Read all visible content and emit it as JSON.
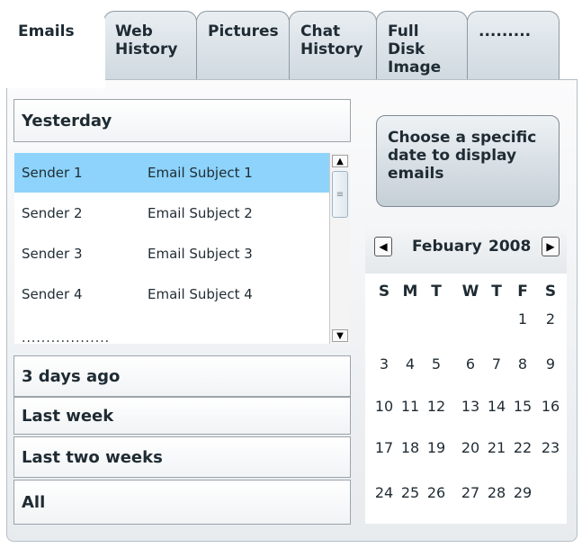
{
  "tabs": [
    {
      "label": "Emails",
      "active": true
    },
    {
      "label": "Web History",
      "active": false
    },
    {
      "label": "Pictures",
      "active": false
    },
    {
      "label": "Chat History",
      "active": false
    },
    {
      "label": "Full Disk Image",
      "active": false
    },
    {
      "label": ".........",
      "active": false
    }
  ],
  "groups": {
    "yesterday": "Yesterday",
    "three_days": "3 days ago",
    "last_week": "Last week",
    "last_two_weeks": "Last two weeks",
    "all": "All"
  },
  "emails": [
    {
      "sender": "Sender 1",
      "subject": "Email Subject 1",
      "selected": true
    },
    {
      "sender": "Sender 2",
      "subject": "Email Subject 2",
      "selected": false
    },
    {
      "sender": "Sender 3",
      "subject": "Email Subject 3",
      "selected": false
    },
    {
      "sender": "Sender 4",
      "subject": "Email Subject 4",
      "selected": false
    }
  ],
  "list_more": "..................",
  "choose_button": "Choose a specific date to display emails",
  "calendar": {
    "month": "Febuary",
    "year": "2008",
    "weekdays": [
      "S",
      "M",
      "T",
      "W",
      "T",
      "F",
      "S"
    ],
    "weeks": [
      [
        "",
        "",
        "",
        "",
        "",
        "1",
        "2"
      ],
      [
        "3",
        "4",
        "5",
        "6",
        "7",
        "8",
        "9"
      ],
      [
        "10",
        "11",
        "12",
        "13",
        "14",
        "15",
        "16"
      ],
      [
        "17",
        "18",
        "19",
        "20",
        "21",
        "22",
        "23"
      ],
      [
        "24",
        "25",
        "26",
        "27",
        "28",
        "29",
        ""
      ]
    ]
  },
  "colors": {
    "selected_row": "#8dd3fb"
  },
  "icons": {
    "prev": "triangle-left",
    "next": "triangle-right",
    "scroll_up": "triangle-up",
    "scroll_down": "triangle-down"
  }
}
